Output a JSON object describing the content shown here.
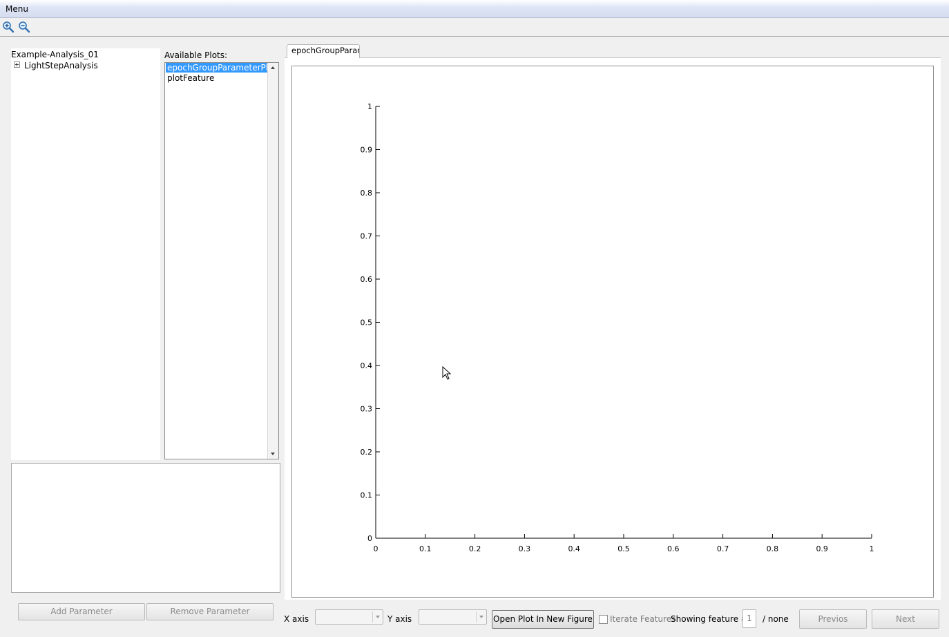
{
  "menubar": {
    "menu_label": "Menu"
  },
  "toolbar": {
    "zoom_in": "zoom-in-icon",
    "zoom_out": "zoom-out-icon"
  },
  "tree": {
    "root": "Example-Analysis_01",
    "children": [
      "LightStepAnalysis"
    ]
  },
  "plots_panel": {
    "label": "Available Plots:",
    "items": [
      "epochGroupParameterPlot",
      "plotFeature"
    ],
    "selected": "epochGroupParameterPlot"
  },
  "params": {
    "add_label": "Add Parameter",
    "remove_label": "Remove Parameter"
  },
  "tab": {
    "label": "epochGroupParameterPlot"
  },
  "chart_data": {
    "type": "line",
    "series": [],
    "xlim": [
      0,
      1
    ],
    "ylim": [
      0,
      1
    ],
    "x_ticks": [
      "0",
      "0.1",
      "0.2",
      "0.3",
      "0.4",
      "0.5",
      "0.6",
      "0.7",
      "0.8",
      "0.9",
      "1"
    ],
    "y_ticks": [
      "0",
      "0.1",
      "0.2",
      "0.3",
      "0.4",
      "0.5",
      "0.6",
      "0.7",
      "0.8",
      "0.9",
      "1"
    ],
    "grid": false,
    "title": "",
    "xlabel": "",
    "ylabel": ""
  },
  "bottom": {
    "x_axis_label": "X axis",
    "y_axis_label": "Y axis",
    "open_plot_label": "Open Plot In New Figure",
    "iterate_label": "Iterate Features",
    "showing_label": "Showing feature #",
    "feature_value": "1",
    "total_label": "/ none",
    "prev_label": "Previos",
    "next_label": "Next"
  },
  "colors": {
    "selection": "#3399ff",
    "menubar": "#dfe6f6"
  }
}
